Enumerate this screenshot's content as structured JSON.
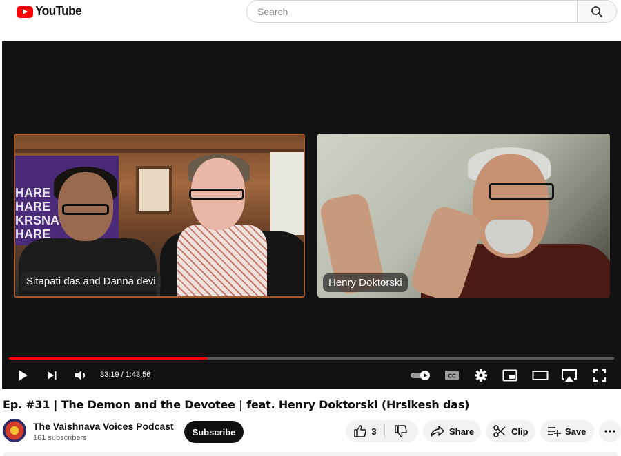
{
  "header": {
    "logo_text": "YouTube",
    "search_placeholder": "Search",
    "search_icon": "search-icon"
  },
  "player": {
    "participants": [
      {
        "name_tag": "Sitapati das and Danna devi"
      },
      {
        "name_tag": "Henry Doktorski"
      }
    ],
    "banner_text": "HARE HARE KRSNA HARE",
    "progress_fraction": 0.328,
    "time_display": "33:19 / 1:43:56",
    "colors": {
      "progress": "#ff0000",
      "player_bg": "#121212"
    },
    "controls": {
      "left": [
        "play-icon",
        "next-icon",
        "volume-icon"
      ],
      "right": [
        "autoplay-toggle-icon",
        "captions-icon",
        "settings-icon",
        "miniplayer-icon",
        "theater-icon",
        "airplay-icon",
        "fullscreen-icon"
      ]
    }
  },
  "video": {
    "title": "Ep. #31 | The Demon and the Devotee | feat. Henry Doktorski (Hrsikesh das)"
  },
  "channel": {
    "name": "The Vaishnava Voices Podcast",
    "subscribers": "161 subscribers",
    "subscribe_label": "Subscribe"
  },
  "actions": {
    "like_count": "3",
    "share_label": "Share",
    "clip_label": "Clip",
    "save_label": "Save"
  }
}
